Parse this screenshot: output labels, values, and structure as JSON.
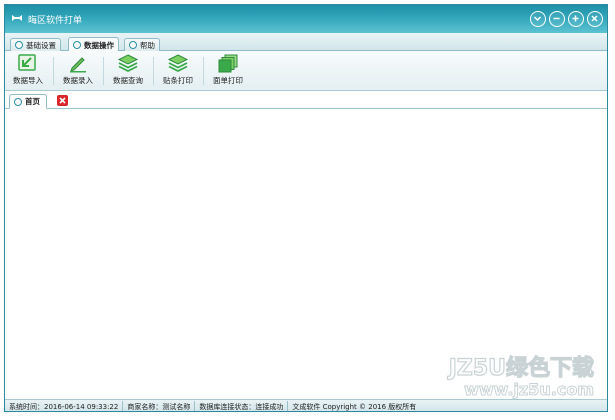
{
  "window": {
    "title": "晦区软件打单"
  },
  "ribbon_tabs": [
    {
      "label": "基础设置"
    },
    {
      "label": "数据操作"
    },
    {
      "label": "帮助"
    }
  ],
  "toolbar": {
    "items": [
      {
        "label": "数据导入",
        "icon": "import-icon"
      },
      {
        "label": "数据录入",
        "icon": "edit-icon"
      },
      {
        "label": "数据查询",
        "icon": "layers-icon"
      },
      {
        "label": "贴条打印",
        "icon": "layers-print-icon"
      },
      {
        "label": "面单打印",
        "icon": "pages-icon"
      }
    ]
  },
  "doc_tabs": [
    {
      "label": "首页"
    }
  ],
  "status": {
    "system_time": "系统时间：2016-06-14 09:33:22",
    "merchant": "商家名称：测试名称",
    "db_state": "数据库连接状态：连接成功",
    "copyright": "文成软件 Copyright © 2016 版权所有"
  },
  "watermark": {
    "line1": "JZ5U绿色下载",
    "line2": "www.jz5u.com"
  },
  "colors": {
    "titlebar": "#2fa3b8",
    "accent": "#2b8ea3",
    "icon_green": "#3aa94a",
    "close_red": "#d8262b"
  }
}
